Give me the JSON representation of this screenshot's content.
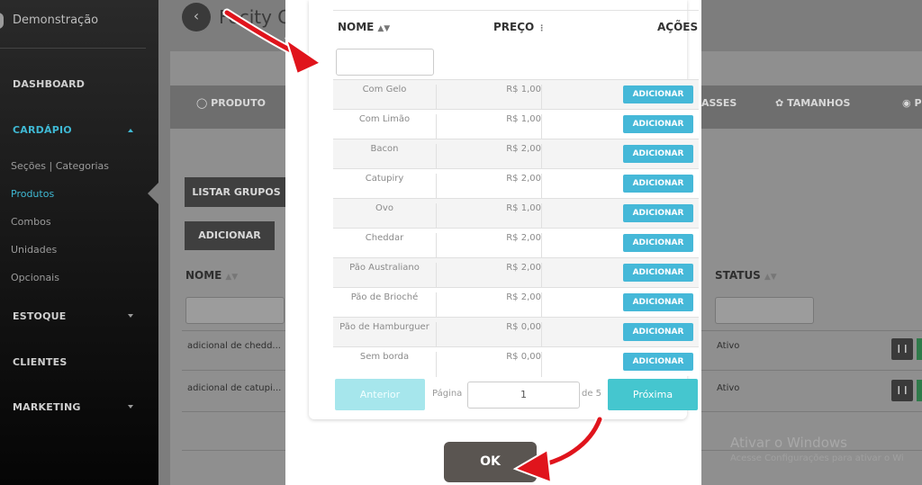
{
  "sidebar": {
    "brand": "Demonstração",
    "dashboard": "DASHBOARD",
    "cardapio": "CARDÁPIO",
    "sub_items": [
      "Seções | Categorias",
      "Produtos",
      "Combos",
      "Unidades",
      "Opcionais"
    ],
    "estoque": "ESTOQUE",
    "clientes": "CLIENTES",
    "marketing": "MARKETING"
  },
  "background": {
    "title": "Fecity Co",
    "tabs": {
      "produto": "PRODUTO",
      "classes": "ASSES",
      "tamanhos": "TAMANHOS",
      "extra": "P"
    },
    "listar_grupos": "LISTAR GRUPOS",
    "adicionar": "ADICIONAR",
    "col_nome": "NOME",
    "col_status": "STATUS",
    "rows": [
      {
        "nome": "adicional de chedd...",
        "status": "Ativo"
      },
      {
        "nome": "adicional de catupi...",
        "status": "Ativo"
      }
    ],
    "windows_line1": "Ativar o Windows",
    "windows_line2": "Acesse Configurações para ativar o Wi"
  },
  "modal": {
    "headers": {
      "nome": "NOME",
      "preco": "PREÇO",
      "acoes": "AÇÕES"
    },
    "add_label": "ADICIONAR",
    "items": [
      {
        "nome": "Com Gelo",
        "preco": "R$ 1,00"
      },
      {
        "nome": "Com Limão",
        "preco": "R$ 1,00"
      },
      {
        "nome": "Bacon",
        "preco": "R$ 2,00"
      },
      {
        "nome": "Catupiry",
        "preco": "R$ 2,00"
      },
      {
        "nome": "Ovo",
        "preco": "R$ 1,00"
      },
      {
        "nome": "Cheddar",
        "preco": "R$ 2,00"
      },
      {
        "nome": "Pão Australiano",
        "preco": "R$ 2,00"
      },
      {
        "nome": "Pão de Brioché",
        "preco": "R$ 2,00"
      },
      {
        "nome": "Pão de Hamburguer",
        "preco": "R$ 0,00"
      },
      {
        "nome": "Sem borda",
        "preco": "R$ 0,00"
      }
    ],
    "pager": {
      "prev": "Anterior",
      "page_label": "Página",
      "page_value": "1",
      "of_label": "de 5",
      "next": "Próxima"
    },
    "ok": "OK"
  },
  "colors": {
    "accent": "#45b8d8",
    "next": "#45c6cf",
    "arrow": "#e0141c"
  }
}
